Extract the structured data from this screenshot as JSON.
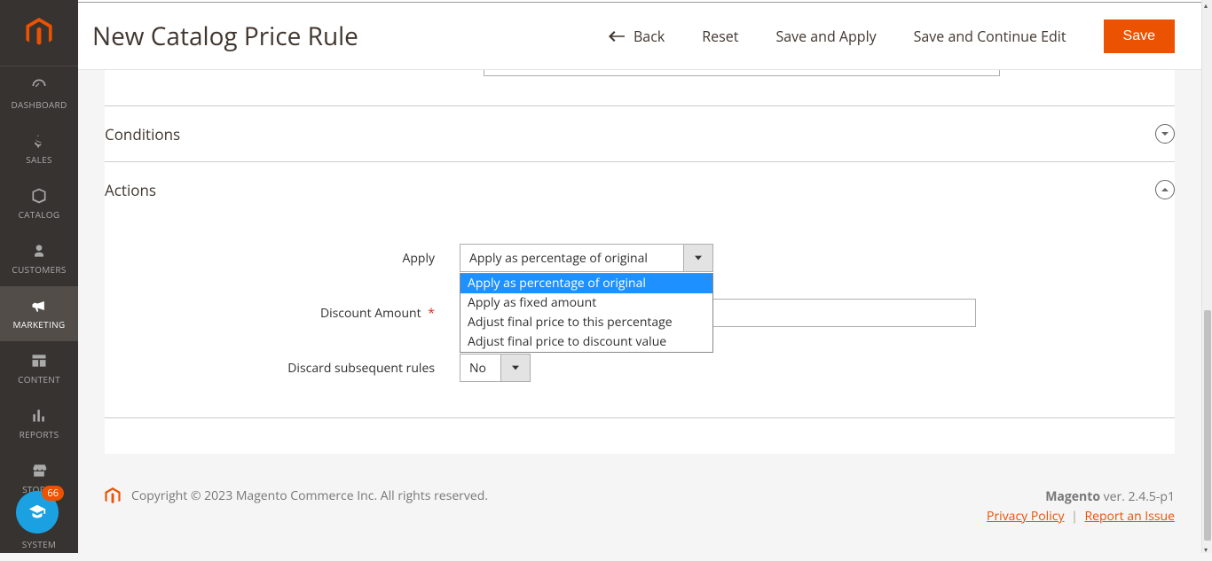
{
  "sidebar": {
    "items": [
      {
        "label": "DASHBOARD"
      },
      {
        "label": "SALES"
      },
      {
        "label": "CATALOG"
      },
      {
        "label": "CUSTOMERS"
      },
      {
        "label": "MARKETING"
      },
      {
        "label": "CONTENT"
      },
      {
        "label": "REPORTS"
      },
      {
        "label": "STORES"
      },
      {
        "label": "SYSTEM"
      }
    ]
  },
  "header": {
    "title": "New Catalog Price Rule",
    "back": "Back",
    "reset": "Reset",
    "save_apply": "Save and Apply",
    "save_continue": "Save and Continue Edit",
    "save": "Save"
  },
  "sections": {
    "conditions": "Conditions",
    "actions": "Actions"
  },
  "form": {
    "apply_label": "Apply",
    "apply_value": "Apply as percentage of original",
    "apply_options": [
      "Apply as percentage of original",
      "Apply as fixed amount",
      "Adjust final price to this percentage",
      "Adjust final price to discount value"
    ],
    "discount_label": "Discount Amount",
    "discard_label": "Discard subsequent rules",
    "discard_value": "No"
  },
  "footer": {
    "copyright": "Copyright © 2023 Magento Commerce Inc. All rights reserved.",
    "brand": "Magento",
    "version": " ver. 2.4.5-p1",
    "privacy": "Privacy Policy",
    "report": "Report an Issue"
  },
  "help_badge": "66"
}
